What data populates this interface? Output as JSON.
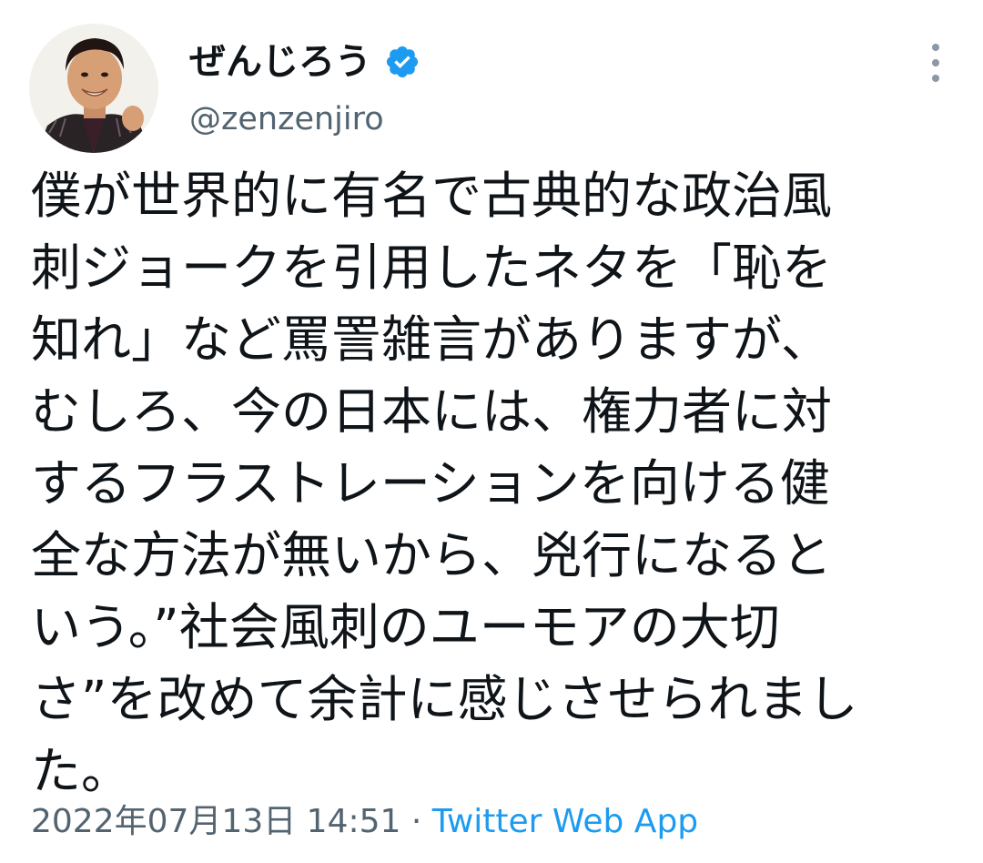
{
  "author": {
    "display_name": "ぜんじろう",
    "handle": "@zenzenjiro",
    "verified": true,
    "verified_icon": "verified-badge-icon",
    "avatar": "avatar-photo"
  },
  "tweet": {
    "lines": [
      "僕が世界的に有名で古典的な政治風",
      "刺ジョークを引用したネタを「恥を",
      "知れ」など罵詈雑言がありますが、",
      "むしろ、今の日本には、権力者に対",
      "するフラストレーションを向ける健",
      "全な方法が無いから、兇行になると",
      "いう。”社会風刺のユーモアの大切",
      "さ”を改めて余計に感じさせられまし",
      "た。"
    ]
  },
  "meta": {
    "timestamp": "2022年07月13日 14:51",
    "separator": " · ",
    "source": "Twitter Web App"
  },
  "menu": {
    "icon": "more-vertical-icon"
  },
  "colors": {
    "text": "#0f1419",
    "secondary": "#536471",
    "accent": "#1d9bf0",
    "verified": "#1d9bf0"
  }
}
